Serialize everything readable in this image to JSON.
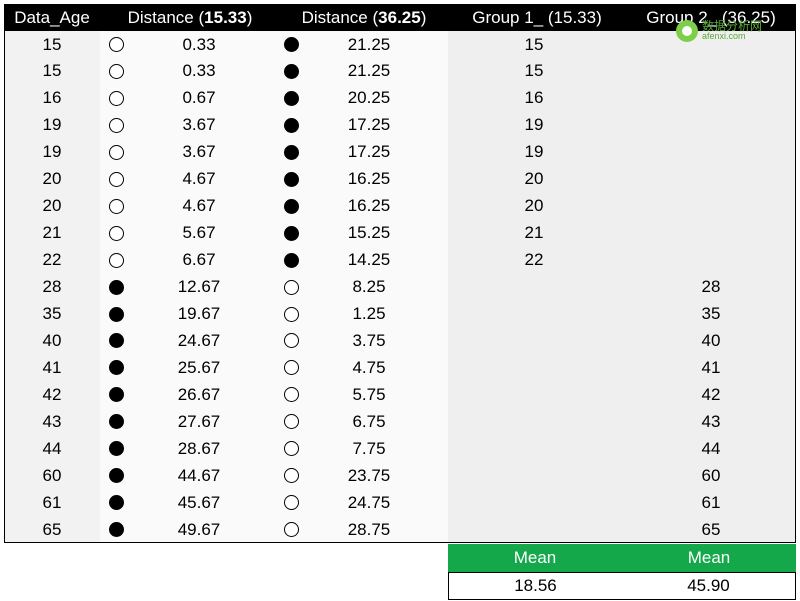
{
  "header": {
    "col_age": "Data_Age",
    "col_d1_prefix": "Distance (",
    "col_d1_value": "15.33",
    "col_d1_suffix": ")",
    "col_d2_prefix": "Distance (",
    "col_d2_value": "36.25",
    "col_d2_suffix": ")",
    "col_g1": "Group 1_ (15.33)",
    "col_g2": "Group 2_ (36.25)"
  },
  "rows": [
    {
      "age": "15",
      "dot1": "hollow",
      "d1": "0.33",
      "dot2": "filled",
      "d2": "21.25",
      "g1": "15",
      "g2": ""
    },
    {
      "age": "15",
      "dot1": "hollow",
      "d1": "0.33",
      "dot2": "filled",
      "d2": "21.25",
      "g1": "15",
      "g2": ""
    },
    {
      "age": "16",
      "dot1": "hollow",
      "d1": "0.67",
      "dot2": "filled",
      "d2": "20.25",
      "g1": "16",
      "g2": ""
    },
    {
      "age": "19",
      "dot1": "hollow",
      "d1": "3.67",
      "dot2": "filled",
      "d2": "17.25",
      "g1": "19",
      "g2": ""
    },
    {
      "age": "19",
      "dot1": "hollow",
      "d1": "3.67",
      "dot2": "filled",
      "d2": "17.25",
      "g1": "19",
      "g2": ""
    },
    {
      "age": "20",
      "dot1": "hollow",
      "d1": "4.67",
      "dot2": "filled",
      "d2": "16.25",
      "g1": "20",
      "g2": ""
    },
    {
      "age": "20",
      "dot1": "hollow",
      "d1": "4.67",
      "dot2": "filled",
      "d2": "16.25",
      "g1": "20",
      "g2": ""
    },
    {
      "age": "21",
      "dot1": "hollow",
      "d1": "5.67",
      "dot2": "filled",
      "d2": "15.25",
      "g1": "21",
      "g2": ""
    },
    {
      "age": "22",
      "dot1": "hollow",
      "d1": "6.67",
      "dot2": "filled",
      "d2": "14.25",
      "g1": "22",
      "g2": ""
    },
    {
      "age": "28",
      "dot1": "filled",
      "d1": "12.67",
      "dot2": "hollow",
      "d2": "8.25",
      "g1": "",
      "g2": "28"
    },
    {
      "age": "35",
      "dot1": "filled",
      "d1": "19.67",
      "dot2": "hollow",
      "d2": "1.25",
      "g1": "",
      "g2": "35"
    },
    {
      "age": "40",
      "dot1": "filled",
      "d1": "24.67",
      "dot2": "hollow",
      "d2": "3.75",
      "g1": "",
      "g2": "40"
    },
    {
      "age": "41",
      "dot1": "filled",
      "d1": "25.67",
      "dot2": "hollow",
      "d2": "4.75",
      "g1": "",
      "g2": "41"
    },
    {
      "age": "42",
      "dot1": "filled",
      "d1": "26.67",
      "dot2": "hollow",
      "d2": "5.75",
      "g1": "",
      "g2": "42"
    },
    {
      "age": "43",
      "dot1": "filled",
      "d1": "27.67",
      "dot2": "hollow",
      "d2": "6.75",
      "g1": "",
      "g2": "43"
    },
    {
      "age": "44",
      "dot1": "filled",
      "d1": "28.67",
      "dot2": "hollow",
      "d2": "7.75",
      "g1": "",
      "g2": "44"
    },
    {
      "age": "60",
      "dot1": "filled",
      "d1": "44.67",
      "dot2": "hollow",
      "d2": "23.75",
      "g1": "",
      "g2": "60"
    },
    {
      "age": "61",
      "dot1": "filled",
      "d1": "45.67",
      "dot2": "hollow",
      "d2": "24.75",
      "g1": "",
      "g2": "61"
    },
    {
      "age": "65",
      "dot1": "filled",
      "d1": "49.67",
      "dot2": "hollow",
      "d2": "28.75",
      "g1": "",
      "g2": "65"
    }
  ],
  "summary": {
    "label_g1": "Mean",
    "label_g2": "Mean",
    "mean_g1": "18.56",
    "mean_g2": "45.90"
  },
  "watermark": {
    "name": "数据分析网",
    "domain": "afenxi.com"
  },
  "colors": {
    "header_bg": "#000000",
    "summary_bg": "#14a84a",
    "logo_green": "#7dcf4a"
  }
}
